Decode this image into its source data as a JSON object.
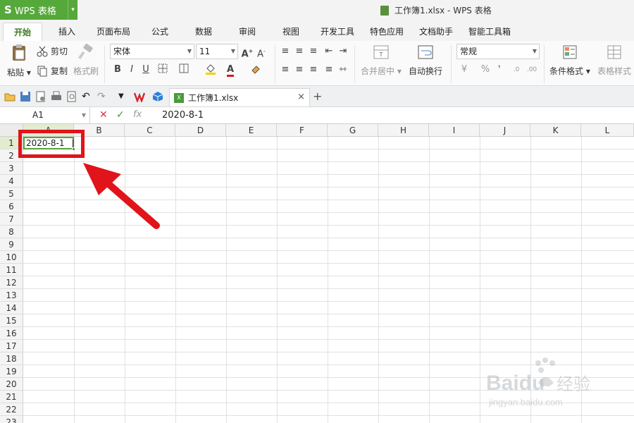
{
  "app": {
    "logo": "S",
    "name": "WPS 表格"
  },
  "window": {
    "title": "工作簿1.xlsx - WPS 表格"
  },
  "tabs": [
    {
      "label": "开始",
      "active": true
    },
    {
      "label": "插入"
    },
    {
      "label": "页面布局"
    },
    {
      "label": "公式"
    },
    {
      "label": "数据"
    },
    {
      "label": "审阅"
    },
    {
      "label": "视图"
    },
    {
      "label": "开发工具"
    },
    {
      "label": "特色应用"
    },
    {
      "label": "文档助手"
    },
    {
      "label": "智能工具箱"
    }
  ],
  "ribbon": {
    "paste": "粘贴",
    "cut": "剪切",
    "copy": "复制",
    "format_painter": "格式刷",
    "font_name": "宋体",
    "font_size": "11",
    "bold": "B",
    "italic": "I",
    "underline": "U",
    "font_color_letter": "A",
    "merge_center": "合并居中",
    "wrap_text": "自动换行",
    "number_format": "常规",
    "percent": "%",
    "comma": "❜",
    "conditional_format": "条件格式",
    "table_style": "表格样式"
  },
  "quick_access": {
    "file_tab": "工作簿1.xlsx",
    "close_symbol": "×",
    "new_tab_symbol": "+"
  },
  "formula_bar": {
    "name_box": "A1",
    "fx": "fx",
    "content": "2020-8-1"
  },
  "grid": {
    "columns": [
      "A",
      "B",
      "C",
      "D",
      "E",
      "F",
      "G",
      "H",
      "I",
      "J",
      "K",
      "L"
    ],
    "rows": [
      "1",
      "2",
      "3",
      "4",
      "5",
      "6",
      "7",
      "8",
      "9",
      "10",
      "11",
      "12",
      "13",
      "14",
      "15",
      "16",
      "17",
      "18",
      "19",
      "20",
      "21",
      "22",
      "23"
    ],
    "active_cell": "A1",
    "cell_a1_value": "2020-8-1"
  },
  "colors": {
    "brand_green": "#55a83a",
    "annotation_red": "#e0141a",
    "selection_green": "#56a33a"
  },
  "watermark": {
    "brand": "Baidu经验",
    "url": "jingyan.baidu.com"
  }
}
